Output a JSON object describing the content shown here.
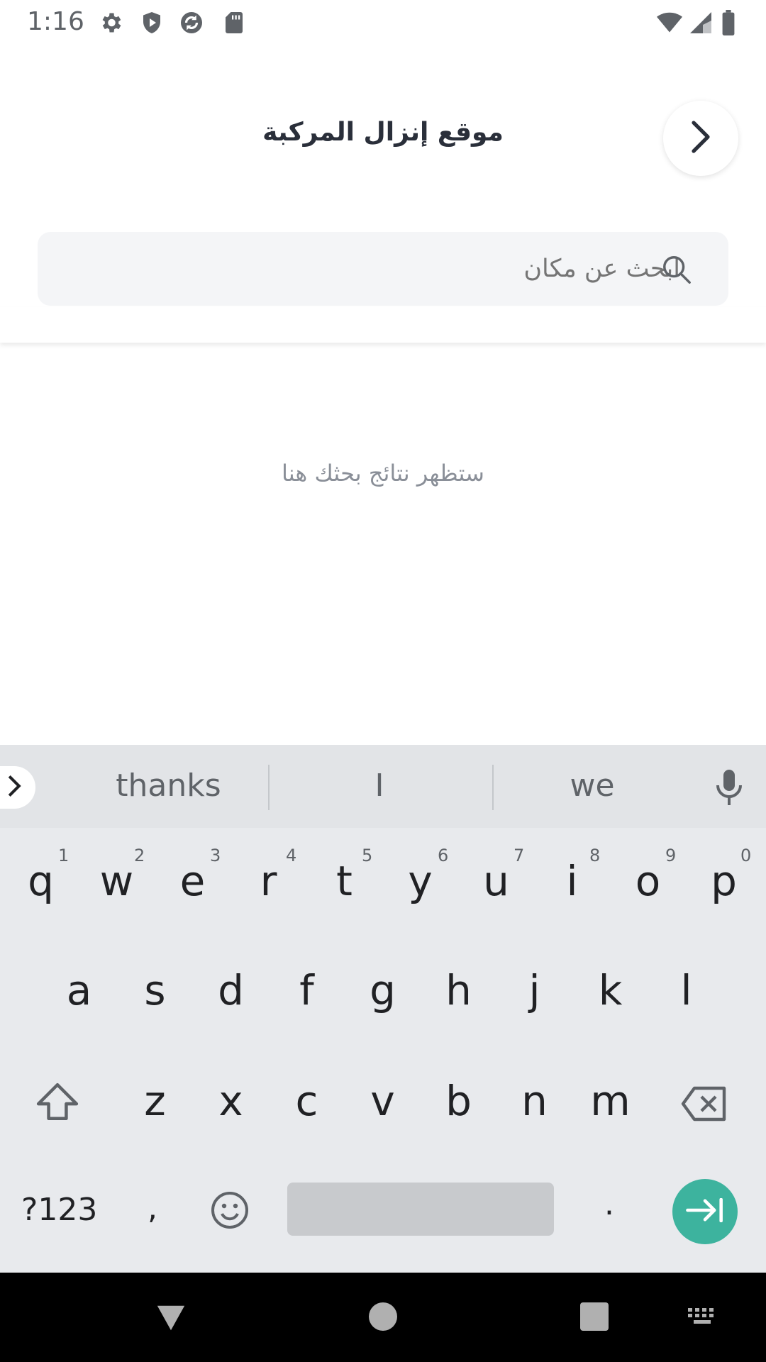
{
  "status_bar": {
    "time": "1:16",
    "left_icons": [
      "gear-icon",
      "shield-icon",
      "sync-icon",
      "sd-card-icon"
    ],
    "right_icons": [
      "wifi-icon",
      "signal-icon",
      "battery-icon"
    ]
  },
  "header": {
    "title": "موقع إنزال المركبة",
    "back_icon": "chevron-right-icon"
  },
  "search": {
    "placeholder": "ابحث عن مكان",
    "value": ""
  },
  "results": {
    "empty_message": "ستظهر نتائج بحثك هنا"
  },
  "keyboard": {
    "suggestions": [
      "thanks",
      "I",
      "we"
    ],
    "row1": [
      "q",
      "w",
      "e",
      "r",
      "t",
      "y",
      "u",
      "i",
      "o",
      "p"
    ],
    "row1_hints": [
      "1",
      "2",
      "3",
      "4",
      "5",
      "6",
      "7",
      "8",
      "9",
      "0"
    ],
    "row2": [
      "a",
      "s",
      "d",
      "f",
      "g",
      "h",
      "j",
      "k",
      "l"
    ],
    "row3": [
      "z",
      "x",
      "c",
      "v",
      "b",
      "n",
      "m"
    ],
    "symbols_label": "?123",
    "comma_label": ",",
    "period_label": "."
  },
  "colors": {
    "accent": "#3db39e",
    "title": "#2a2f3a",
    "keyboard_bg": "#e8eaed"
  }
}
